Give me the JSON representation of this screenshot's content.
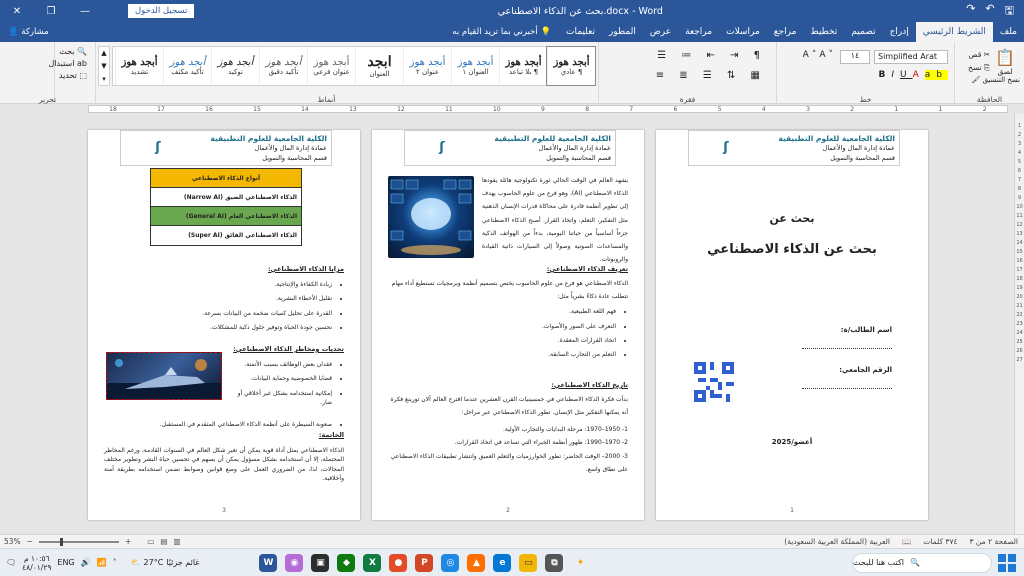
{
  "titlebar": {
    "title": "بحث عن الذكاء الاصطناعي.docx - Word",
    "login_label": "تسجيل الدخول",
    "save_icon": "save-icon",
    "undo_icon": "undo-icon",
    "redo_icon": "redo-icon"
  },
  "tabs": {
    "items": [
      "ملف",
      "الشريط الرئيسي",
      "إدراج",
      "تصميم",
      "تخطيط",
      "مراجع",
      "مراسلات",
      "مراجعة",
      "عرض",
      "المطور",
      "تعليمات"
    ],
    "active_index": 1,
    "tell_me": "أخبرني بما تريد القيام به",
    "share": "مشاركة"
  },
  "ribbon": {
    "clipboard": {
      "paste": "لصق",
      "cut": "قص",
      "copy": "نسخ",
      "format_painter": "نسخ التنسيق",
      "label": "الحافظة"
    },
    "font": {
      "name": "Simplified Arat",
      "size": "١٤",
      "label": "خط"
    },
    "paragraph": {
      "label": "فقرة"
    },
    "styles": {
      "label": "أنماط",
      "items": [
        {
          "sample": "أبجد هوز",
          "name": "¶ عادي"
        },
        {
          "sample": "أبجد هوز",
          "name": "¶ بلا تباعد"
        },
        {
          "sample": "أبجد هوز",
          "name": "العنوان ١"
        },
        {
          "sample": "أبجد هوز",
          "name": "عنوان ٢"
        },
        {
          "sample": "ابجد",
          "name": "العنوان"
        },
        {
          "sample": "أبجد هوز",
          "name": "عنوان فرعي"
        },
        {
          "sample": "أبجد هوز",
          "name": "تأكيد دقيق"
        },
        {
          "sample": "أبجد هوز",
          "name": "توكيد"
        },
        {
          "sample": "أبجد هوز",
          "name": "تأكيد مكثف"
        },
        {
          "sample": "أبجد هوز",
          "name": "تشديد"
        }
      ]
    },
    "editing": {
      "find": "بحث",
      "replace": "استبدال",
      "select": "تحديد",
      "label": "تحرير"
    }
  },
  "ruler": {
    "numbers": [
      "18",
      "17",
      "16",
      "15",
      "14",
      "13",
      "12",
      "11",
      "10",
      "9",
      "8",
      "7",
      "6",
      "5",
      "4",
      "3",
      "2",
      "1",
      "1",
      "2"
    ]
  },
  "pages": {
    "p1": {
      "header": {
        "line1": "الكلية الجامعية للعلوم التطبيقية",
        "line2": "عمادة إدارة المال والأعمال",
        "line3": "قسم المحاسبة والتمويل",
        "logo_text": "الكلية الجامعية للعلوم التطبيقية"
      },
      "t1": "بحث عن",
      "t2": "بحث عن الذكاء الاصطناعي",
      "student": "اسم الطالب/ة:",
      "uni_no": "الرقم الجامعي:",
      "teacher": "أعضو/2025",
      "num": "1"
    },
    "p2": {
      "header": {
        "line1": "الكلية الجامعية للعلوم التطبيقية",
        "line2": "عمادة إدارة المال والأعمال",
        "line3": "قسم المحاسبة والتمويل"
      },
      "intro": "يشهد العالم في الوقت الحالي ثورة تكنولوجية هائلة يقودها الذكاء الاصطناعي (AI)، وهو فرع من علوم الحاسوب يهدف إلى تطوير أنظمة قادرة على محاكاة قدرات الإنسان الذهنية مثل التفكير، التعلم، واتخاذ القرار. أصبح الذكاء الاصطناعي جزءاً أساسياً من حياتنا اليومية، بدءاً من الهواتف الذكية والمساعدات الصوتية وصولاً إلى السيارات ذاتية القيادة والروبوتات.",
      "def_h": "تعريف الذكاء الاصطناعي:",
      "def": "الذكاء الاصطناعي هو فرع من علوم الحاسوب يختص بتصميم أنظمة وبرمجيات تستطيع أداء مهام تتطلب عادة ذكاءً بشرياً مثل:",
      "def_items": [
        "فهم اللغة الطبيعية.",
        "التعرف على الصور والأصوات.",
        "اتخاذ القرارات المعقدة.",
        "التعلم من التجارب السابقة."
      ],
      "hist_h": "تاريخ الذكاء الاصطناعي:",
      "hist": "بدأت فكرة الذكاء الاصطناعي في خمسينيات القرن العشرين عندما اقترح العالم آلان تورينغ فكرة أنه يمكنها التفكير مثل الإنسان. تطور الذكاء الاصطناعي عبر مراحل:",
      "hist_items": [
        "1- 1950–1970: مرحلة البدايات والتجارب الأولية.",
        "2- 1970–1990: ظهور أنظمة الخبراء التي تساعد في اتخاذ القرارات.",
        "3- 2000– الوقت الحاضر: تطور الخوارزميات والتعلم العميق وانتشار تطبيقات الذكاء الاصطناعي على نطاق واسع."
      ],
      "num": "2"
    },
    "p3": {
      "header": {
        "line1": "الكلية الجامعية للعلوم التطبيقية",
        "line2": "عمادة إدارة المال والأعمال",
        "line3": "قسم المحاسبة والتمويل"
      },
      "table": [
        "أنواع الذكاء الاصطناعي",
        "الذكاء الاصطناعي الضيق (Narrow AI)",
        "الذكاء الاصطناعي العام (General AI)",
        "الذكاء الاصطناعي الفائق (Super AI)"
      ],
      "adv_h": "مزايا الذكاء الاصطناعي:",
      "adv": [
        "زيادة الكفاءة والإنتاجية.",
        "تقليل الأخطاء البشرية.",
        "القدرة على تحليل كميات ضخمة من البيانات بسرعة.",
        "تحسين جودة الحياة وتوفير حلول ذكية للمشكلات."
      ],
      "risk_h": "تحديات ومخاطر الذكاء الاصطناعي:",
      "risk": [
        "فقدان بعض الوظائف بسبب الأتمتة.",
        "قضايا الخصوصية وحماية البيانات.",
        "إمكانية استخدامه بشكل غير أخلاقي أو ضار.",
        "صعوبة السيطرة على أنظمة الذكاء الاصطناعي المتقدم في المستقبل."
      ],
      "concl_h": "الخاتمة:",
      "concl": "الذكاء الاصطناعي يمثل أداة قوية يمكن أن تغير شكل العالم في السنوات القادمة، ورغم المخاطر المحتملة، إلا أن استخدامه بشكل مسؤول يمكن أن يسهم في تحسين حياة البشر وتطوير مختلف المجالات، لذا، من الضروري العمل على وضع قوانين وضوابط تضمن استخدامه بطريقة آمنة وأخلاقية.",
      "num": "3"
    }
  },
  "status": {
    "page": "الصفحة ٢ من ٣",
    "words": "٣٧٤ كلمات",
    "lang": "العربية (المملكة العربية السعودية)",
    "zoom": "53%",
    "zoom_level": 0.53
  },
  "taskbar": {
    "search_placeholder": "اكتب هنا للبحث",
    "weather": "27°C",
    "weather_desc": "غائم جزئيًا",
    "input_lang": "ENG",
    "time": "١٠:٥٦ م",
    "date": "٤٨/٠١/٢٩"
  },
  "colors": {
    "brand": "#2b579a",
    "table_yellow": "#f5b800",
    "table_green": "#6aa84f"
  }
}
